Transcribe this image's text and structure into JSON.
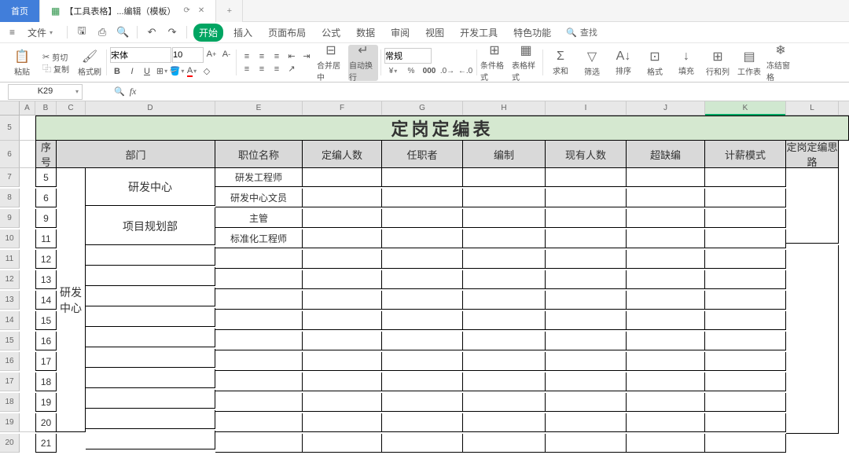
{
  "tabs": {
    "home": "首页",
    "doc": "【工具表格】...编辑（模板）"
  },
  "menu": {
    "file": "文件",
    "start": "开始",
    "insert": "插入",
    "layout": "页面布局",
    "formula": "公式",
    "data": "数据",
    "review": "审阅",
    "view": "视图",
    "dev": "开发工具",
    "special": "特色功能",
    "search": "查找"
  },
  "ribbon": {
    "paste": "粘贴",
    "cut": "剪切",
    "copy": "复制",
    "painter": "格式刷",
    "font": "宋体",
    "size": "10",
    "merge": "合并居中",
    "wrap": "自动换行",
    "numfmt": "常规",
    "cond": "条件格式",
    "tableStyle": "表格样式",
    "sum": "求和",
    "filter": "筛选",
    "sort": "排序",
    "format": "格式",
    "fill": "填充",
    "rowcol": "行和列",
    "worksheet": "工作表",
    "freeze": "冻结窗格"
  },
  "namebox": "K29",
  "columns": [
    "A",
    "B",
    "C",
    "D",
    "E",
    "F",
    "G",
    "H",
    "I",
    "J",
    "K",
    "L"
  ],
  "activeCol": "K",
  "title": "定岗定编表",
  "headers": {
    "seq": "序\n号",
    "dept": "部门",
    "position": "职位名称",
    "plan": "定编人数",
    "holder": "任职者",
    "est": "编制",
    "actual": "现有人数",
    "vacancy": "超缺编",
    "salary": "计薪模式",
    "thinking": "定岗定编思路"
  },
  "rows": [
    5,
    6,
    9,
    11,
    12,
    13,
    14,
    15,
    16,
    17,
    18,
    19,
    20,
    21
  ],
  "rowIdx": [
    7,
    8,
    9,
    10,
    11,
    12,
    13,
    14,
    15,
    16,
    17,
    18,
    19,
    20
  ],
  "dept": {
    "rd": "研发中心",
    "plan": "项目规划部"
  },
  "pos": {
    "rd_eng": "研发工程师",
    "rd_clerk": "研发中心文员",
    "supervisor": "主管",
    "std_eng": "标准化工程师"
  }
}
